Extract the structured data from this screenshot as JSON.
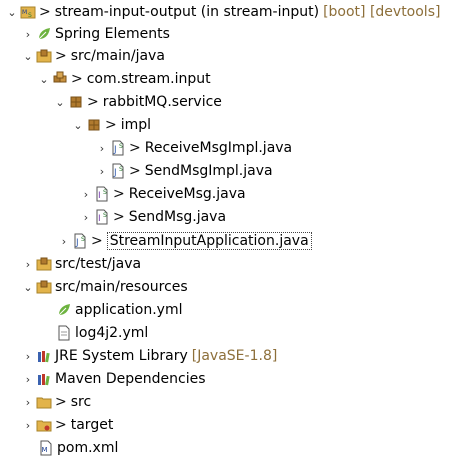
{
  "project": {
    "dirty_mark": ">",
    "label": "stream-input-output (in stream-input)",
    "decorations": "[boot] [devtools]"
  },
  "spring_elements": {
    "label": "Spring Elements"
  },
  "src_main_java": {
    "dirty_mark": ">",
    "label": "src/main/java"
  },
  "pkg_com": {
    "dirty_mark": ">",
    "label": "com.stream.input"
  },
  "pkg_service": {
    "dirty_mark": ">",
    "label": "rabbitMQ.service"
  },
  "pkg_impl": {
    "dirty_mark": ">",
    "label": "impl"
  },
  "receive_impl": {
    "dirty_mark": ">",
    "label": "ReceiveMsgImpl.java"
  },
  "send_impl": {
    "dirty_mark": ">",
    "label": "SendMsgImpl.java"
  },
  "receive_msg": {
    "dirty_mark": ">",
    "label": "ReceiveMsg.java"
  },
  "send_msg": {
    "dirty_mark": ">",
    "label": "SendMsg.java"
  },
  "app": {
    "dirty_mark": ">",
    "label": "StreamInputApplication.java"
  },
  "src_test_java": {
    "label": "src/test/java"
  },
  "src_main_resources": {
    "label": "src/main/resources"
  },
  "application_yml": {
    "label": "application.yml"
  },
  "log4j2_yml": {
    "label": "log4j2.yml"
  },
  "jre": {
    "label": "JRE System Library",
    "decoration": "[JavaSE-1.8]"
  },
  "maven": {
    "label": "Maven Dependencies"
  },
  "src_folder": {
    "dirty_mark": ">",
    "label": "src"
  },
  "target_folder": {
    "dirty_mark": ">",
    "label": "target"
  },
  "pom": {
    "label": "pom.xml"
  },
  "colors": {
    "decoration": "#8d6f3a",
    "folder": "#e2b34a",
    "package": "#b07a2e",
    "java_blue": "#3a62b0",
    "spring_green": "#6db33f"
  },
  "icons": {
    "project": "maven-project-icon",
    "spring": "spring-leaf-icon",
    "source_folder": "source-folder-icon",
    "package": "package-icon",
    "java_file": "java-file-icon",
    "yml_file": "yml-file-icon",
    "library": "library-icon",
    "folder": "folder-icon",
    "xml_file": "xml-file-icon"
  }
}
